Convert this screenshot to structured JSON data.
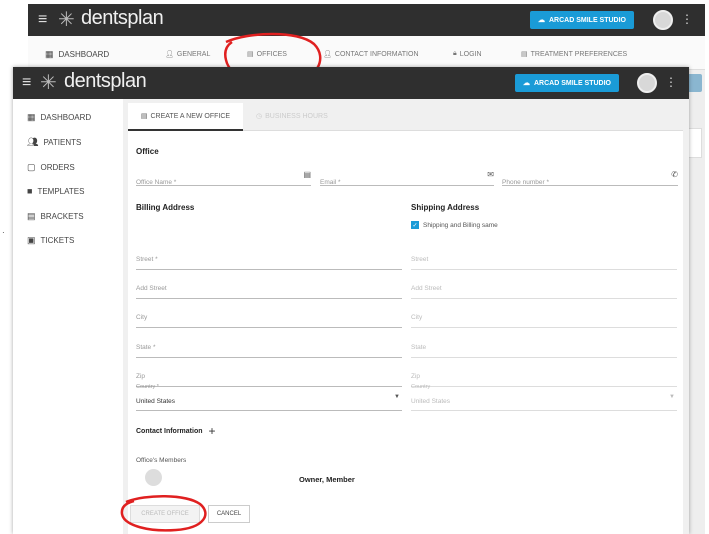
{
  "back_window": {
    "logo": "dentsplan",
    "studio_button": "ARCAD SMILE STUDIO",
    "sidebar_first": "DASHBOARD",
    "tabs": [
      {
        "label": "GENERAL",
        "icon": "person-icon"
      },
      {
        "label": "OFFICES",
        "icon": "office-icon"
      },
      {
        "label": "CONTACT INFORMATION",
        "icon": "person-icon"
      },
      {
        "label": "LOGIN",
        "icon": "lock-icon"
      },
      {
        "label": "TREATMENT PREFERENCES",
        "icon": "clipboard-icon"
      }
    ]
  },
  "front_window": {
    "logo": "dentsplan",
    "studio_button": "ARCAD SMILE STUDIO",
    "sidebar": [
      {
        "label": "DASHBOARD",
        "icon": "dashboard-icon"
      },
      {
        "label": "PATIENTS",
        "icon": "people-icon"
      },
      {
        "label": "ORDERS",
        "icon": "clipboard-icon"
      },
      {
        "label": "TEMPLATES",
        "icon": "template-icon"
      },
      {
        "label": "BRACKETS",
        "icon": "bracket-icon"
      },
      {
        "label": "TICKETS",
        "icon": "ticket-icon"
      }
    ],
    "tabs": [
      {
        "label": "CREATE A NEW OFFICE",
        "icon": "office-icon"
      },
      {
        "label": "BUSINESS HOURS",
        "icon": "clock-icon"
      }
    ],
    "form": {
      "office_title": "Office",
      "office_name": "Office Name *",
      "email": "Email *",
      "phone": "Phone number *",
      "billing_title": "Billing Address",
      "shipping_title": "Shipping Address",
      "same_checkbox": "Shipping and Billing same",
      "billing_fields": [
        "Street *",
        "Add Street",
        "City",
        "State *",
        "Zip"
      ],
      "shipping_fields": [
        "Street",
        "Add Street",
        "City",
        "State",
        "Zip"
      ],
      "country_label": "Country *",
      "country_value": "United States",
      "shipping_country_label": "Country",
      "shipping_country_value": "United States",
      "contact_info": "Contact Information",
      "members_label": "Office's Members",
      "member_role": "Owner, Member",
      "create_button": "CREATE OFFICE",
      "cancel_button": "CANCEL"
    }
  }
}
